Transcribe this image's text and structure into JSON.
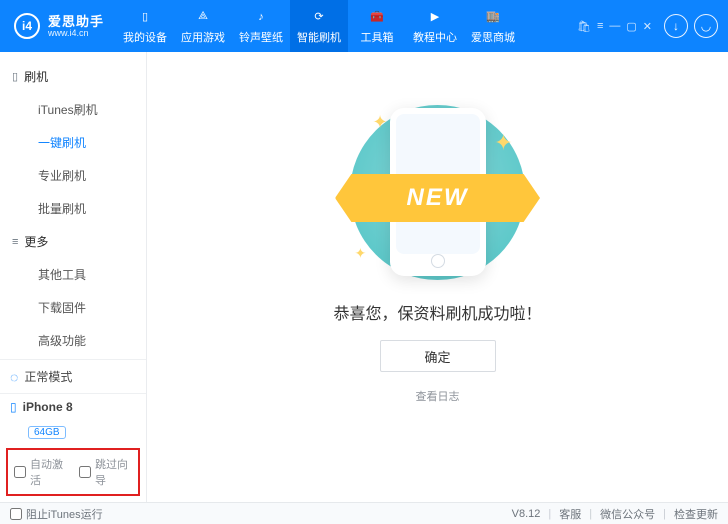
{
  "header": {
    "logoText": "i4",
    "brandCn": "爱思助手",
    "brandUrl": "www.i4.cn",
    "nav": [
      "我的设备",
      "应用游戏",
      "铃声壁纸",
      "智能刷机",
      "工具箱",
      "教程中心",
      "爱思商城"
    ],
    "navActiveIndex": 3
  },
  "sidebar": {
    "group1Title": "刷机",
    "group1Items": [
      "iTunes刷机",
      "一键刷机",
      "专业刷机",
      "批量刷机"
    ],
    "group1ActiveIndex": 1,
    "group2Title": "更多",
    "group2Items": [
      "其他工具",
      "下载固件",
      "高级功能"
    ]
  },
  "status": {
    "mode": "正常模式"
  },
  "device": {
    "name": "iPhone 8",
    "storage": "64GB"
  },
  "checks": {
    "autoActivate": "自动激活",
    "skipGuide": "跳过向导"
  },
  "content": {
    "ribbon": "NEW",
    "title": "恭喜您，保资料刷机成功啦！",
    "okBtn": "确定",
    "logLink": "查看日志"
  },
  "footer": {
    "blockITunes": "阻止iTunes运行",
    "version": "V8.12",
    "support": "客服",
    "wechat": "微信公众号",
    "update": "检查更新"
  }
}
